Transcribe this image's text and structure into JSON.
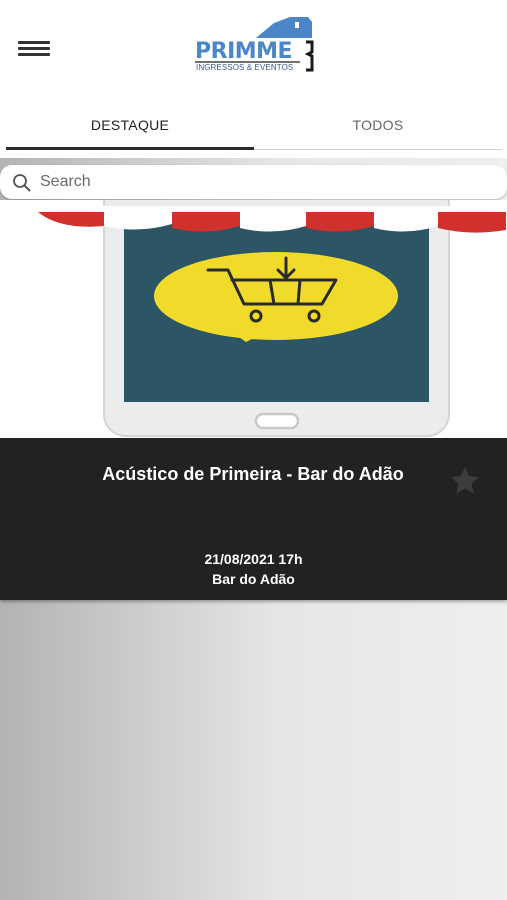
{
  "header": {
    "logo_text": "PRIMME",
    "logo_tagline": "INGRESSOS & EVENTOS",
    "menu_icon": "hamburger-menu-icon"
  },
  "tabs": [
    {
      "label": "DESTAQUE",
      "active": true
    },
    {
      "label": "TODOS",
      "active": false
    }
  ],
  "search": {
    "placeholder": "Search",
    "value": "",
    "icon": "search-icon"
  },
  "featured_event": {
    "title": "Acústico de Primeira - Bar do Adão",
    "date": "21/08/2021 17h",
    "venue": "Bar do Adão",
    "favorite_icon": "star-icon",
    "favorited": false,
    "image": "shop-phone-cart-illustration"
  },
  "colors": {
    "brand_blue": "#4a86c8",
    "card_bg": "#222222",
    "awning_red": "#d0312d",
    "screen_teal": "#2c5566",
    "bubble_yellow": "#f0da2a"
  }
}
